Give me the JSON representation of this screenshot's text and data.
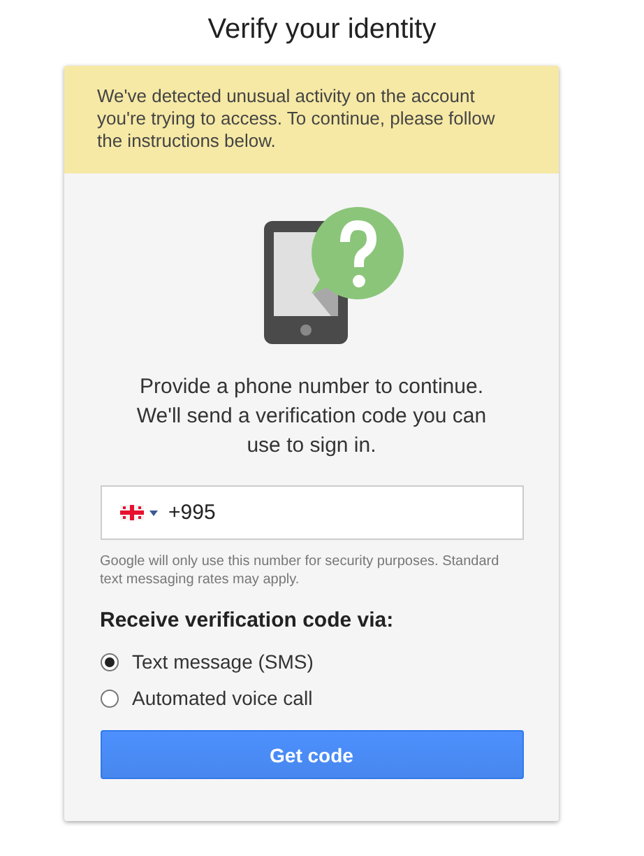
{
  "title": "Verify your identity",
  "notice": "We've detected unusual activity on the account you're trying to access. To continue, please follow the instructions below.",
  "prompt": "Provide a phone number to continue. We'll send a verification code you can use to sign in.",
  "phone": {
    "value": "+995"
  },
  "disclaimer": "Google will only use this number for security purposes. Standard text messaging rates may apply.",
  "method_heading": "Receive verification code via:",
  "methods": [
    {
      "label": "Text message (SMS)",
      "selected": true
    },
    {
      "label": "Automated voice call",
      "selected": false
    }
  ],
  "submit": "Get code"
}
